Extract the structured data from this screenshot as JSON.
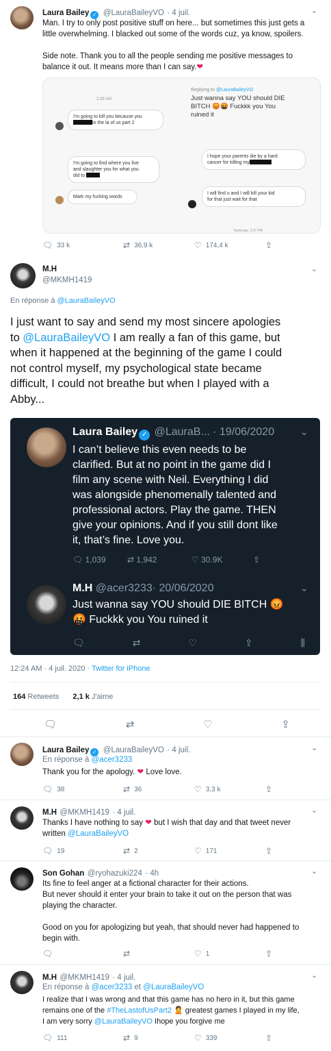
{
  "tweet1": {
    "name": "Laura Bailey",
    "handle": "@LauraBaileyVO",
    "date": "· 4 juil.",
    "text_lines": [
      "Man. I try to only post positive stuff on here... but sometimes this just gets a",
      "little overwhelming. I blacked out some of the words cuz, ya know, spoilers."
    ],
    "text2_lines": [
      "Side note. Thank you to all the people sending me positive messages to",
      "balance it out. It means more than I can say."
    ],
    "screenshot": {
      "time_top": "2:38 AM",
      "msg1_prefix": "I'm going to kill you because you",
      "msg1_suffix": "in the la of us part 2",
      "msg2_l1": "I'm going to find where you live",
      "msg2_l2": "and slaughter you for what you",
      "msg2_l3": "did to",
      "msg3": "Mark my fucking words",
      "replying": "Replying to",
      "replying_handle": "@LauraBaileyVO",
      "reply_l1": "Just wanna say YOU should DIE",
      "reply_l2": "BITCH 😡🤬 Fuckkk you You",
      "reply_l3": "ruined it",
      "msg4_l1": "I hope your parents die by a hard",
      "msg4_l2": "cancer for killing my",
      "msg5_l1": "I will find u and I will kill your kid",
      "msg5_l2": "for that just wait for that",
      "time_bottom": "Yesterday, 2:37 PM"
    },
    "replies": "33 k",
    "retweets": "36,9 k",
    "likes": "174,4 k"
  },
  "main": {
    "name": "M.H",
    "handle": "@MKMH1419",
    "reply_to_label": "En réponse à",
    "reply_to_handle": "@LauraBaileyVO",
    "text_l1": "I just want to say and send my most sincere apologies",
    "text_l2_pre": "to",
    "text_l2_link": "@LauraBaileyVO",
    "text_l2_post": "I am really a fan of this game, but",
    "text_l3": "when it happened at the beginning of the game I could",
    "text_l4": "not control myself, my psychological state became",
    "text_l5": "difficult, I could not breathe but when I played with a",
    "text_l6": "Abby...",
    "dark": {
      "name": "Laura Bailey",
      "handle": "@LauraB...",
      "date": "· 19/06/2020",
      "lines": [
        "I can’t believe this even needs to be",
        "clarified. But at no point in the game did I",
        "film any scene with Neil. Everything I did",
        "was alongside phenomenally talented and",
        "professional actors. Play the game. THEN",
        "give your opinions. And if you still dont like",
        "it, that’s fine. Love you."
      ],
      "replies": "1,039",
      "retweets": "1,942",
      "likes": "30.9K",
      "reply_name": "M.H",
      "reply_handle": "@acer3233",
      "reply_date": "· 20/06/2020",
      "reply_l1": "Just wanna say YOU should DIE BITCH 😡",
      "reply_l2": "🤬 Fuckkk you You ruined it"
    },
    "timestamp": "12:24 AM · 4 juil. 2020",
    "source": "· Twitter for iPhone",
    "retweet_count": "164",
    "retweet_label": "Retweets",
    "like_count": "2,1 k",
    "like_label": "J'aime"
  },
  "reply1": {
    "name": "Laura Bailey",
    "handle": "@LauraBaileyVO",
    "date": "· 4 juil.",
    "reply_to_label": "En réponse à",
    "reply_to_handle": "@acer3233",
    "text": "Thank you for the apology.",
    "text_end": "Love love.",
    "replies": "38",
    "retweets": "36",
    "likes": "3,3 k"
  },
  "reply2": {
    "name": "M.H",
    "handle": "@MKMH1419",
    "date": "· 4 juil.",
    "text_pre": "Thanks I have nothing to say",
    "text_post": "but I wish that day and that tweet never",
    "text_l2_pre": "written",
    "text_l2_link": "@LauraBaileyVO",
    "replies": "19",
    "retweets": "2",
    "likes": "171"
  },
  "reply3": {
    "name": "Son Gohan",
    "handle": "@ryohazuki224",
    "date": "· 4h",
    "lines": [
      "Its fine to feel anger at a fictional  character for their actions.",
      "But never should it enter your brain to take it out on the person that was",
      "playing the character."
    ],
    "lines2": [
      "Good on you for apologizing but yeah, that should never had happened to",
      "begin with."
    ],
    "likes": "1"
  },
  "reply4": {
    "name": "M.H",
    "handle": "@MKMH1419",
    "date": "· 4 juil.",
    "reply_to_label": "En réponse à",
    "reply_to_handle1": "@acer3233",
    "reply_to_and": "et",
    "reply_to_handle2": "@LauraBaileyVO",
    "l1": "I realize that I was wrong and that this game has no hero in it, but this game",
    "l2_pre": "remains one of the",
    "l2_link": "#TheLastofUsPart2",
    "l2_post": "greatest games I played in my life,",
    "l3_pre": "I am very sorry",
    "l3_link": "@LauraBaileyVO",
    "l3_post": "Ihope you forgive me",
    "replies": "111",
    "retweets": "9",
    "likes": "339"
  }
}
